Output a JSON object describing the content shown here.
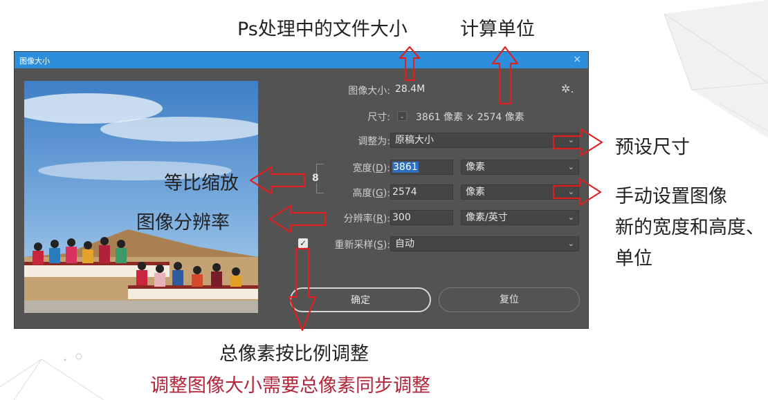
{
  "annotations": {
    "file_size_label": "Ps处理中的文件大小",
    "units_label": "计算单位",
    "preset_label": "预设尺寸",
    "constrain_label": "等比缩放",
    "resolution_label": "图像分辨率",
    "manual_line1": "手动设置图像",
    "manual_line2": "新的宽度和高度、",
    "manual_line3": "单位",
    "resample_label": "总像素按比例调整",
    "resize_note": "调整图像大小需要总像素同步调整"
  },
  "dialog": {
    "title": "图像大小",
    "close_glyph": "×",
    "image_size_label": "图像大小:",
    "image_size_value": "28.4M",
    "gear_glyph": "✲.",
    "dimensions_label": "尺寸:",
    "dimensions_value": "3861 像素 × 2574 像素",
    "fit_to_label": "调整为:",
    "fit_to_value": "原稿大小",
    "width_label_pre": "宽度(",
    "width_label_key": "D",
    "width_label_post": "):",
    "width_value": "3861",
    "width_unit": "像素",
    "height_label_pre": "高度(",
    "height_label_key": "G",
    "height_label_post": "):",
    "height_value": "2574",
    "height_unit": "像素",
    "resolution_label_pre": "分辨率(",
    "resolution_label_key": "R",
    "resolution_label_post": "):",
    "resolution_value": "300",
    "resolution_unit": "像素/英寸",
    "resample_label_pre": "重新采样(",
    "resample_label_key": "S",
    "resample_label_post": "):",
    "resample_checked": true,
    "resample_value": "自动",
    "ok_label": "确定",
    "reset_label": "复位"
  },
  "icons": {
    "caret": "⌄",
    "link": "8",
    "check": "✓"
  },
  "colors": {
    "titlebar": "#2d8fdc",
    "dialog_bg": "#535353",
    "arrow_red": "#e02020",
    "note_red": "#b3263a"
  }
}
